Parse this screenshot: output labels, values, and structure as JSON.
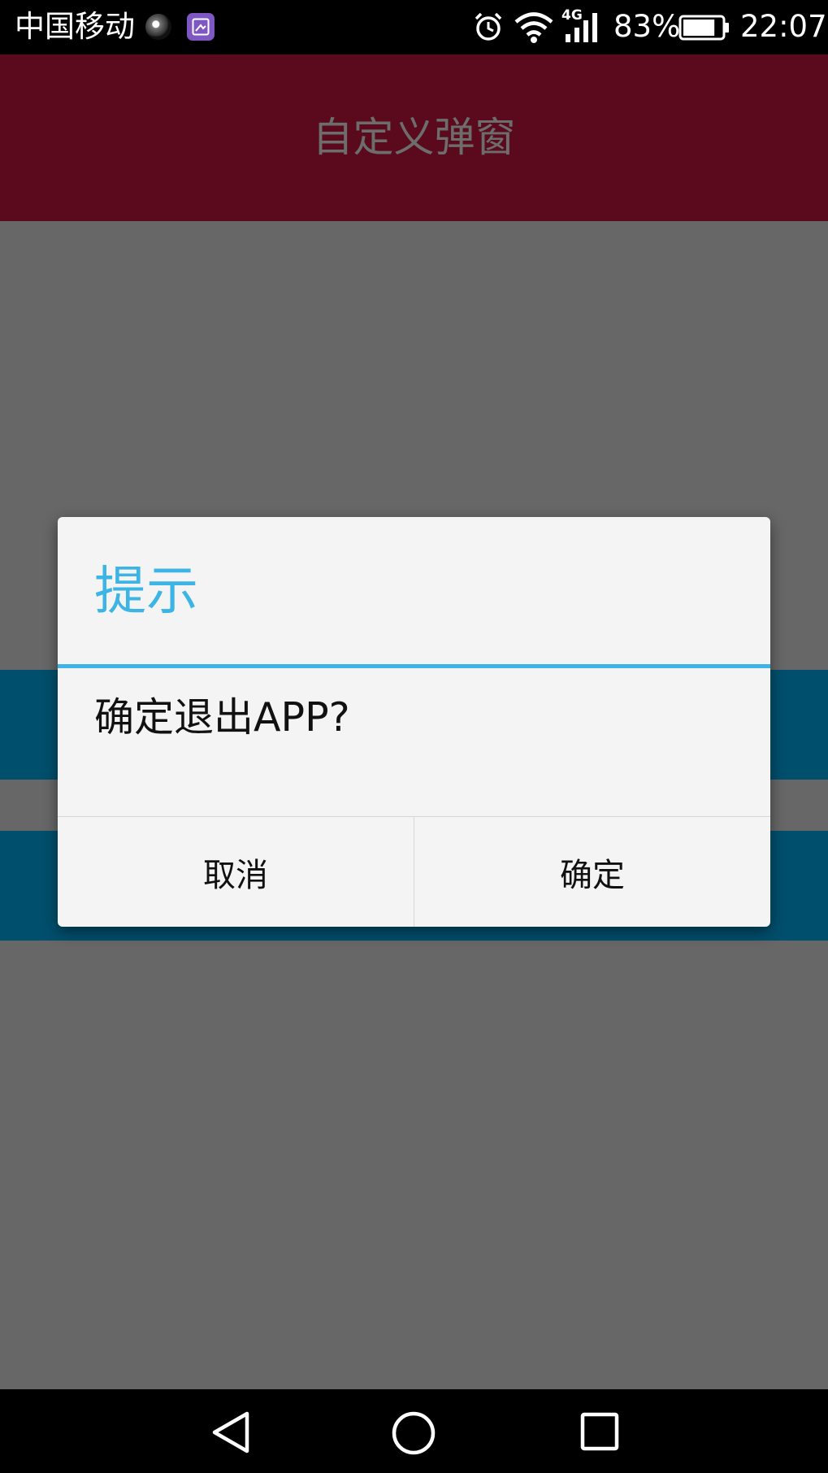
{
  "status_bar": {
    "carrier": "中国移动",
    "network_type": "4G",
    "battery_percent": "83%",
    "battery_level": 0.83,
    "time": "22:07",
    "icons": [
      "game-notification-icon",
      "gallery-notification-icon",
      "alarm-icon",
      "wifi-icon",
      "signal-icon",
      "battery-icon"
    ]
  },
  "app": {
    "title": "自定义弹窗",
    "header_color": "#5a0a1c",
    "button_color": "#004f6d"
  },
  "dialog": {
    "title": "提示",
    "message": "确定退出APP?",
    "cancel_label": "取消",
    "confirm_label": "确定",
    "accent_color": "#3cb4e5"
  },
  "nav_bar": {
    "icons": [
      "back-icon",
      "home-icon",
      "recent-apps-icon"
    ]
  }
}
